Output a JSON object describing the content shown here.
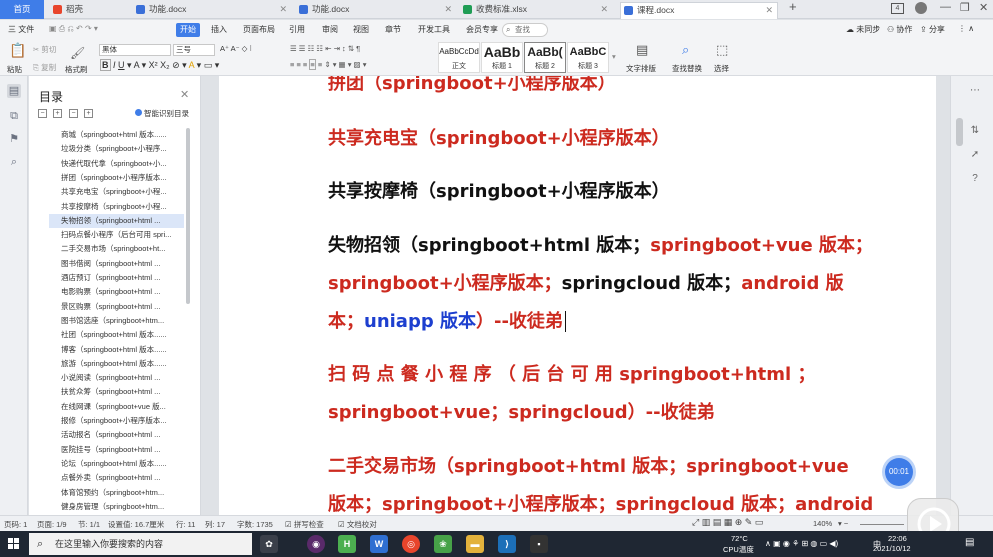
{
  "tabs": {
    "home": "首页",
    "items": [
      {
        "label": "稻壳",
        "icon_color": "#e8452c"
      },
      {
        "label": "功能.docx",
        "icon_color": "#3a6fd8"
      },
      {
        "label": "功能.docx",
        "icon_color": "#3a6fd8"
      },
      {
        "label": "收费标准.xlsx",
        "icon_color": "#1f9d55"
      },
      {
        "label": "课程.docx",
        "icon_color": "#3a6fd8",
        "active": true
      }
    ],
    "new_tab": "+"
  },
  "menu": {
    "file": "三 文件",
    "items": [
      "开始",
      "插入",
      "页面布局",
      "引用",
      "审阅",
      "视图",
      "章节",
      "开发工具",
      "会员专享"
    ],
    "search": "查找",
    "right": [
      "未同步",
      "协作",
      "分享"
    ]
  },
  "ribbon": {
    "paste": "粘贴",
    "cut": "剪切",
    "copy": "复制",
    "format_painter": "格式刷",
    "font_name": "黑体",
    "font_size": "三号",
    "styles": [
      {
        "preview": "AaBbCcDd",
        "name": "正文"
      },
      {
        "preview": "AaBb",
        "name": "标题 1"
      },
      {
        "preview": "AaBb(",
        "name": "标题 2"
      },
      {
        "preview": "AaBbC",
        "name": "标题 3"
      }
    ],
    "text_layout": "文字排版",
    "find_replace": "查找替换",
    "select": "选择"
  },
  "toc": {
    "title": "目录",
    "smart": "智能识别目录",
    "items": [
      "商城（springboot+html 版本......",
      "垃圾分类（springboot+小程序...",
      "快递代取代拿（springboot+小...",
      "拼团（springboot+小程序版本...",
      "共享充电宝（springboot+小程...",
      "共享按摩椅（springboot+小程...",
      "失物招领（springboot+html ...",
      "扫码点餐小程序（后台可用 spri...",
      "二手交易市场（springboot+ht...",
      "图书借阅（springboot+html ...",
      "酒店预订（springboot+html ...",
      "电影购票（springboot+html ...",
      "景区购票（springboot+html ...",
      "图书馆选座（springboot+htm...",
      "社团（springboot+html 版本......",
      "博客（springboot+html 版本......",
      "旅游（springboot+html 版本......",
      "小说阅读（springboot+html ...",
      "扶贫众筹（springboot+html ...",
      "在线网课（springboot+vue 版...",
      "报修（springboot+小程序版本...",
      "活动报名（springboot+html ...",
      "医院挂号（springboot+html ...",
      "论坛（springboot+html 版本......",
      "点餐外卖（springboot+html ...",
      "体育馆预约（springboot+htm...",
      "健身房管理（springboot+htm..."
    ],
    "selected_index": 6
  },
  "document": {
    "p_top": "拼团（springboot+小程序版本）",
    "p1": "共享充电宝（springboot+小程序版本）",
    "p2": "共享按摩椅（springboot+小程序版本）",
    "p3_l1_a": "失物招领（springboot+html 版本；",
    "p3_l1_b": "springboot+vue 版本；",
    "p3_l2_a": "springboot+小程序版本；",
    "p3_l2_b": "springcloud 版本；",
    "p3_l2_c": "android 版",
    "p3_l3_a": "本；",
    "p3_l3_b": "uniapp 版本",
    "p3_l3_c": "）--收徒弟",
    "p4_l1": "扫 码 点 餐 小 程 序 （ 后 台 可 用  springboot+html ；",
    "p4_l2": "springboot+vue；springcloud）--收徒弟",
    "p5_l1": "二手交易市场（springboot+html 版本；springboot+vue",
    "p5_l2": "版本；springboot+小程序版本；springcloud 版本；android"
  },
  "timer": "00:01",
  "status": {
    "page_num": "页码: 1",
    "page": "页面: 1/9",
    "section": "节: 1/1",
    "setting": "设置值: 16.7厘米",
    "row": "行: 11",
    "col": "列: 17",
    "words": "字数: 1735",
    "spell": "拼写检查",
    "compare": "文档校对",
    "zoom": "140%"
  },
  "taskbar": {
    "search_placeholder": "在这里输入你要搜索的内容",
    "weather_temp": "72°C",
    "weather_label": "CPU温度",
    "ime": "中",
    "time": "22:06",
    "date": "2021/10/12"
  }
}
